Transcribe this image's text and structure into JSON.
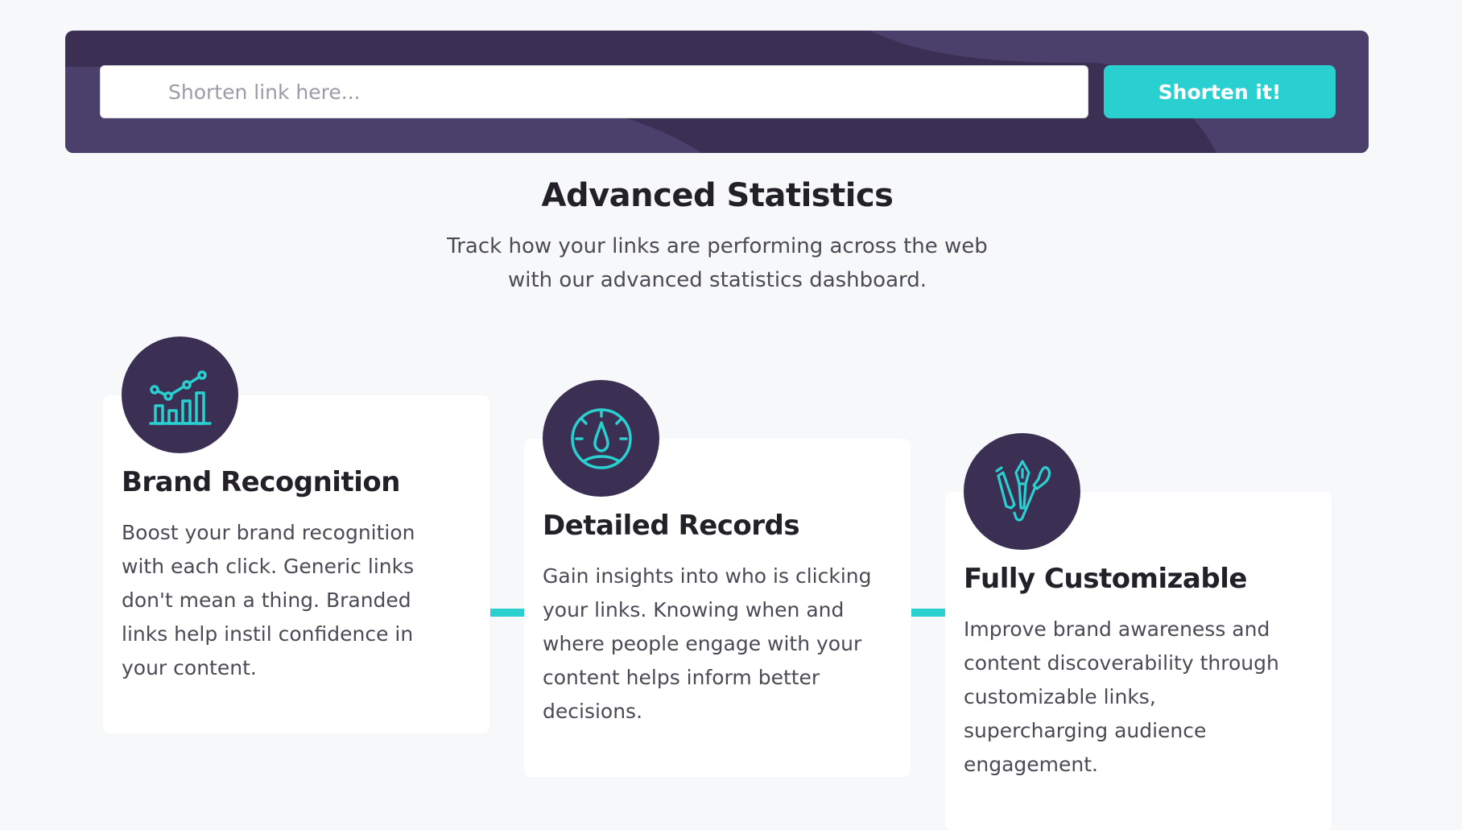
{
  "shorten": {
    "placeholder": "Shorten link here...",
    "value": "",
    "button_label": "Shorten it!"
  },
  "stats": {
    "title": "Advanced Statistics",
    "subtitle_line1": "Track how your links are performing across the web",
    "subtitle_line2": "with our advanced statistics dashboard."
  },
  "features": [
    {
      "icon": "chart-icon",
      "title": "Brand Recognition",
      "text": "Boost your brand recognition with each click. Generic links don't mean a thing. Branded links help instil confidence in your content."
    },
    {
      "icon": "gauge-icon",
      "title": "Detailed Records",
      "text": "Gain insights into who is clicking your links. Knowing when and where people engage with your content helps inform better decisions."
    },
    {
      "icon": "tools-icon",
      "title": "Fully Customizable",
      "text": "Improve brand awareness and content discoverability through customizable links, supercharging audience engagement."
    }
  ],
  "colors": {
    "accent": "#2acfcf",
    "panel": "#3b3054",
    "panel_shape": "#4b3f6b",
    "heading": "#232127",
    "body_text": "#4b4a55",
    "page_bg": "#f7f8fa"
  }
}
